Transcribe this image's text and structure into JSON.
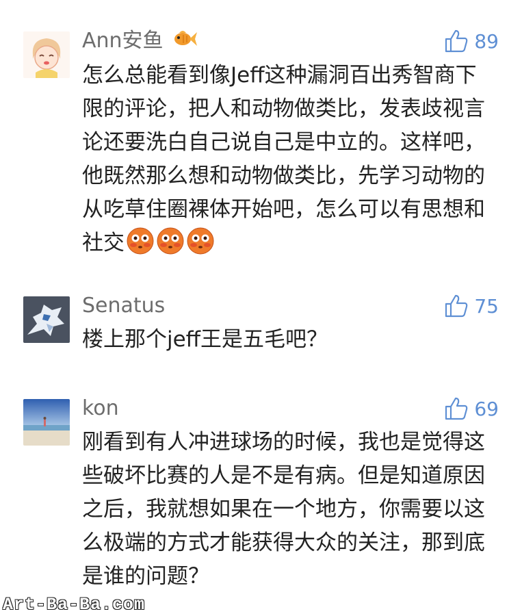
{
  "comments": [
    {
      "username": "Ann安鱼",
      "badge_icon": "goldfish-icon",
      "likes": "89",
      "text": "怎么总能看到像Jeff这种漏洞百出秀智商下限的评论，把人和动物做类比，发表歧视言论还要洗白自己说自己是中立的。这样吧，他既然那么想和动物做类比，先学习动物的从吃草住圈裸体开始吧，怎么可以有思想和社交",
      "emoji": [
        "flushed-face-emoji",
        "flushed-face-emoji",
        "flushed-face-emoji"
      ]
    },
    {
      "username": "Senatus",
      "likes": "75",
      "text": "楼上那个jeff王是五毛吧？"
    },
    {
      "username": "kon",
      "likes": "69",
      "text": "刚看到有人冲进球场的时候，我也是觉得这些破坏比赛的人是不是有病。但是知道原因之后，我就想如果在一个地方，你需要以这么极端的方式才能获得大众的关注，那到底是谁的问题？"
    }
  ],
  "watermark": "Art-Ba-Ba.com",
  "colors": {
    "like_blue": "#5e8fd4",
    "username_gray": "#6d6d6d",
    "text": "#222222"
  }
}
